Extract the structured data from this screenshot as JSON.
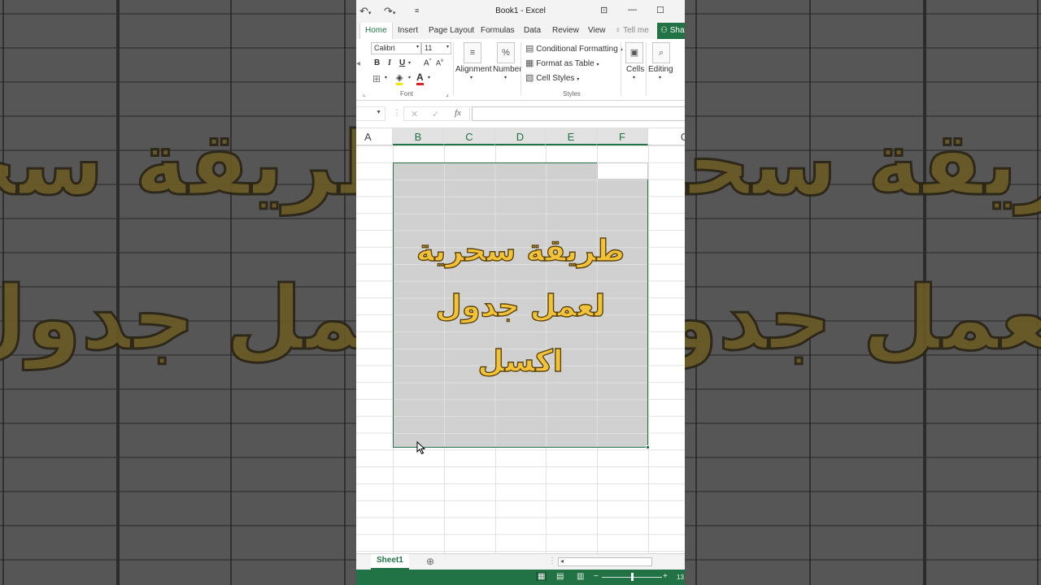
{
  "app": {
    "title": "Book1 - Excel",
    "accent_color": "#217346"
  },
  "quick_access": {
    "undo_icon": "undo-icon",
    "redo_icon": "redo-icon",
    "customize_icon": "customize-qat-icon"
  },
  "window_controls": {
    "ribbon_display_icon": "ribbon-display-icon",
    "minimize_icon": "minimize-icon",
    "maximize_icon": "maximize-icon"
  },
  "tabs": [
    {
      "label": "Home",
      "active": true
    },
    {
      "label": "Insert"
    },
    {
      "label": "Page Layout"
    },
    {
      "label": "Formulas"
    },
    {
      "label": "Data"
    },
    {
      "label": "Review"
    },
    {
      "label": "View"
    }
  ],
  "tell_me": "Tell me",
  "share_label": "Sha",
  "ribbon": {
    "font": {
      "name": "Calibri",
      "size": "11",
      "bold": "B",
      "italic": "I",
      "underline": "U",
      "grow": "A",
      "shrink": "A",
      "group_label": "Font"
    },
    "alignment_label": "Alignment",
    "number_label": "Number",
    "number_symbol": "%",
    "styles": {
      "conditional_formatting": "Conditional Formatting",
      "format_as_table": "Format as Table",
      "cell_styles": "Cell Styles",
      "group_label": "Styles"
    },
    "cells_label": "Cells",
    "editing_label": "Editing"
  },
  "formula_bar": {
    "fx": "fx",
    "value": ""
  },
  "columns": [
    "A",
    "B",
    "C",
    "D",
    "E",
    "F",
    "G"
  ],
  "selected_columns": [
    "B",
    "C",
    "D",
    "E",
    "F"
  ],
  "overlay": {
    "line1": "طريقة سحرية",
    "line2": "لعمل جدول",
    "line3": "اكسل",
    "text_color": "#f4c236"
  },
  "sheets": [
    {
      "name": "Sheet1",
      "active": true
    }
  ],
  "status": {
    "zoom_label": "13"
  }
}
